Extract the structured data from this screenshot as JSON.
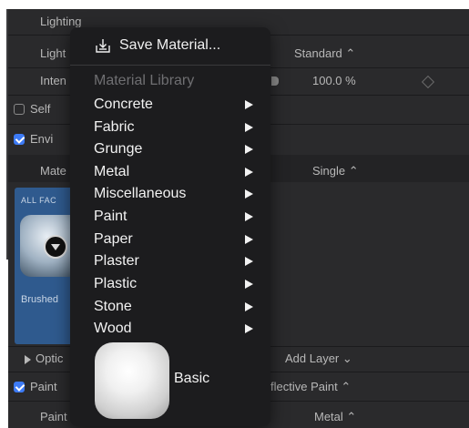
{
  "inspector": {
    "section_title": "Lighting",
    "light_label": "Light",
    "light_value": "Standard ⌃",
    "intensity_label": "Inten",
    "intensity_value": "100.0 %",
    "self_shadow_label": "Self",
    "env_label": "Envi",
    "material_label": "Mate",
    "material_value": "Single ⌃",
    "tile_all_faces": "ALL FAC",
    "tile_label": "Brushed",
    "options_label": "Optic",
    "add_layer": "Add Layer ⌄",
    "paint_label": "Paint",
    "paint_value": "flective Paint ⌃",
    "paint2_label": "Paint",
    "paint2_value": "Metal ⌃"
  },
  "menu": {
    "save_label": "Save Material...",
    "library_header": "Material Library",
    "items": [
      "Concrete",
      "Fabric",
      "Grunge",
      "Metal",
      "Miscellaneous",
      "Paint",
      "Paper",
      "Plaster",
      "Plastic",
      "Stone",
      "Wood"
    ],
    "preset_label": "Basic"
  },
  "icons": {
    "save": "save-tray-icon",
    "submenu": "triangle-right-icon",
    "checkbox_checked": "checkmark-icon",
    "keyframe": "diamond-icon"
  },
  "colors": {
    "panel_bg": "#2a2a2c",
    "menu_bg": "#1c1c1e",
    "accent_blue": "#3d7bf6",
    "tile_blue": "#2f5a8e"
  }
}
